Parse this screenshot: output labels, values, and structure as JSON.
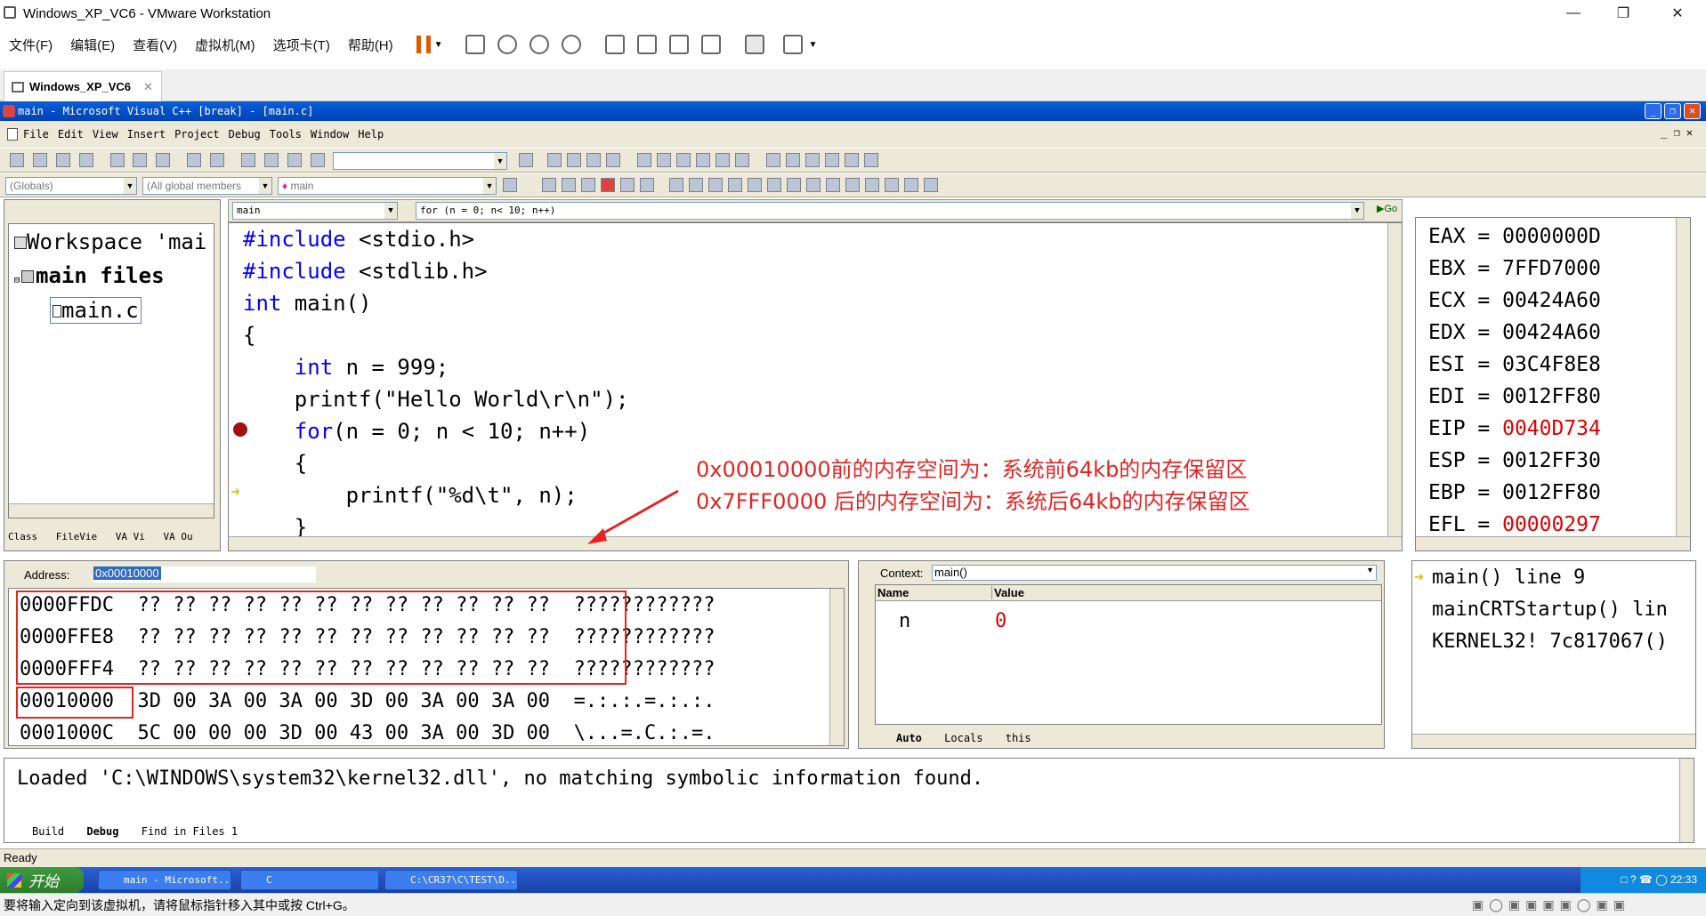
{
  "vmware": {
    "title": "Windows_XP_VC6 - VMware Workstation",
    "menu": [
      "文件(F)",
      "编辑(E)",
      "查看(V)",
      "虚拟机(M)",
      "选项卡(T)",
      "帮助(H)"
    ],
    "tab": "Windows_XP_VC6",
    "status": "要将输入定向到该虚拟机，请将鼠标指针移入其中或按 Ctrl+G。"
  },
  "vc": {
    "title": "main - Microsoft Visual C++ [break] - [main.c]",
    "menu": [
      "File",
      "Edit",
      "View",
      "Insert",
      "Project",
      "Debug",
      "Tools",
      "Window",
      "Help"
    ],
    "combo_globals": "(Globals)",
    "combo_members": "(All global members",
    "combo_main": "main",
    "func_combo": "main",
    "context_combo": "for (n = 0; n< 10; n++)",
    "go_label": "Go",
    "workspace": {
      "root": "Workspace 'mai",
      "folder": "main files",
      "file": "main.c",
      "tabs": [
        "Class",
        "FileVie",
        "VA Vi",
        "VA Ou"
      ]
    },
    "code_lines": [
      {
        "pre": "",
        "kw": "#include",
        "post": " <stdio.h>"
      },
      {
        "pre": "",
        "kw": "#include",
        "post": " <stdlib.h>"
      },
      {
        "pre": "",
        "kw": "int",
        "post": " main()"
      },
      {
        "pre": "{",
        "kw": "",
        "post": ""
      },
      {
        "pre": "    ",
        "kw": "int",
        "post": " n = 999;"
      },
      {
        "pre": "    printf(\"Hello World\\r\\n\");",
        "kw": "",
        "post": ""
      },
      {
        "pre": "    ",
        "kw": "for",
        "post": "(n = 0; n < 10; n++)"
      },
      {
        "pre": "    {",
        "kw": "",
        "post": ""
      },
      {
        "pre": "        printf(\"%d\\t\", n);",
        "kw": "",
        "post": ""
      },
      {
        "pre": "    }",
        "kw": "",
        "post": ""
      }
    ],
    "annotation_1": "0x00010000前的内存空间为：系统前64kb的内存保留区",
    "annotation_2": "0x7FFF0000 后的内存空间为：系统后64kb的内存保留区",
    "registers": [
      {
        "name": "EAX",
        "value": "0000000D",
        "changed": false
      },
      {
        "name": "EBX",
        "value": "7FFD7000",
        "changed": false
      },
      {
        "name": "ECX",
        "value": "00424A60",
        "changed": false
      },
      {
        "name": "EDX",
        "value": "00424A60",
        "changed": false
      },
      {
        "name": "ESI",
        "value": "03C4F8E8",
        "changed": false
      },
      {
        "name": "EDI",
        "value": "0012FF80",
        "changed": false
      },
      {
        "name": "EIP",
        "value": "0040D734",
        "changed": true
      },
      {
        "name": "ESP",
        "value": "0012FF30",
        "changed": false
      },
      {
        "name": "EBP",
        "value": "0012FF80",
        "changed": false
      },
      {
        "name": "EFL",
        "value": "00000297",
        "changed": true
      }
    ],
    "memory": {
      "address_label": "Address:",
      "address_value": "0x00010000",
      "rows": [
        {
          "addr": "0000FFDC",
          "bytes": "?? ?? ?? ?? ?? ?? ?? ?? ?? ?? ?? ??",
          "ascii": "????????????"
        },
        {
          "addr": "0000FFE8",
          "bytes": "?? ?? ?? ?? ?? ?? ?? ?? ?? ?? ?? ??",
          "ascii": "????????????"
        },
        {
          "addr": "0000FFF4",
          "bytes": "?? ?? ?? ?? ?? ?? ?? ?? ?? ?? ?? ??",
          "ascii": "????????????"
        },
        {
          "addr": "00010000",
          "bytes": "3D 00 3A 00 3A 00 3D 00 3A 00 3A 00",
          "ascii": "=.:.:.=.:.:."
        },
        {
          "addr": "0001000C",
          "bytes": "5C 00 00 00 3D 00 43 00 3A 00 3D 00",
          "ascii": "\\...=.C.:.=."
        }
      ]
    },
    "variables": {
      "context_label": "Context:",
      "context_value": "main()",
      "col_name": "Name",
      "col_value": "Value",
      "rows": [
        {
          "name": "n",
          "value": "0"
        }
      ],
      "tabs": [
        "Auto",
        "Locals",
        "this"
      ]
    },
    "callstack": [
      "main() line 9",
      "mainCRTStartup() lin",
      "KERNEL32! 7c817067()"
    ],
    "output": {
      "text": "Loaded 'C:\\WINDOWS\\system32\\kernel32.dll', no matching symbolic information found.",
      "tabs": [
        "Build",
        "Debug",
        "Find in Files 1"
      ]
    },
    "status": "Ready"
  },
  "taskbar": {
    "start": "开始",
    "tasks": [
      "main - Microsoft...",
      "C",
      "C:\\CR37\\C\\TEST\\D..."
    ],
    "clock": "22:33"
  },
  "colors": {
    "xp_blue": "#0041b8",
    "annotation_red": "#e32424",
    "keyword_blue": "#0000ff"
  }
}
